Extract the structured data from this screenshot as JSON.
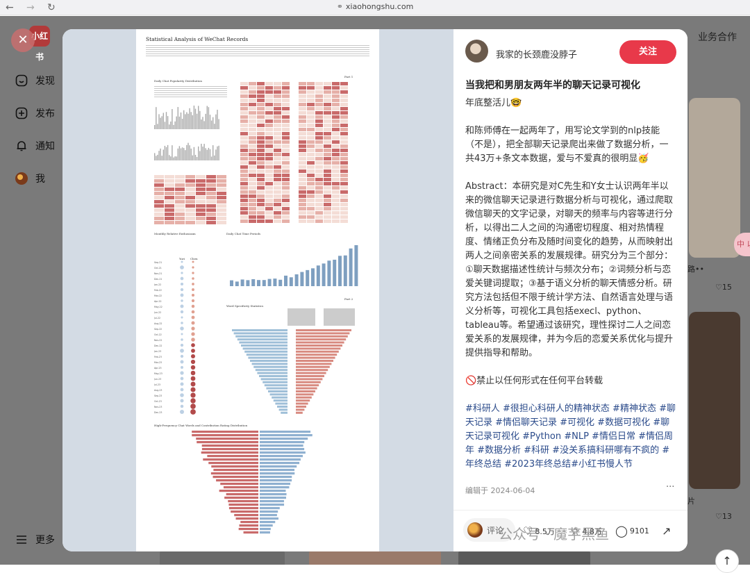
{
  "browser": {
    "url": "xiaohongshu.com"
  },
  "logo": "小红书",
  "sidebar": {
    "items": [
      {
        "label": "发现",
        "icon": "compass-icon"
      },
      {
        "label": "发布",
        "icon": "plus-square-icon"
      },
      {
        "label": "通知",
        "icon": "bell-icon"
      },
      {
        "label": "我",
        "icon": "avatar-icon"
      }
    ],
    "more": "更多"
  },
  "header": {
    "business": "业务合作"
  },
  "background": {
    "likes_a": "15",
    "likes_b": "13",
    "snippet_a": "路••",
    "snippet_b": "片"
  },
  "paper": {
    "title": "Statistical Analysis of WeChat Records",
    "part1": "Part 1",
    "part2": "Part 2",
    "sec_daily": "Daily Chat Popularity Distribution",
    "sec_monthly": "Monthly Relative Enthusiasm",
    "sec_time": "Daily Chat Time Periods",
    "sec_word": "Word Specificity Statistics",
    "sec_freq": "High-Frequency Chat Words and Contribution Rating Distribution",
    "col_a": "Yuri",
    "col_b": "Chen",
    "months": [
      "Sep-21",
      "Oct-21",
      "Nov-21",
      "Dec-21",
      "Jan-22",
      "Feb-22",
      "Mar-22",
      "Apr-22",
      "May-22",
      "Jun-22",
      "Jul-22",
      "Aug-22",
      "Sep-22",
      "Oct-22",
      "Nov-22",
      "Dec-22",
      "Jan-23",
      "Feb-23",
      "Mar-23",
      "Apr-23",
      "May-23",
      "Jun-23",
      "Jul-23",
      "Aug-23",
      "Sep-23",
      "Oct-23",
      "Nov-23",
      "Dec-23"
    ]
  },
  "author": {
    "name": "我家的长颈鹿没脖子",
    "follow": "关注"
  },
  "note": {
    "title": "当我把和男朋友两年半的聊天记录可视化",
    "intro": "年底整活儿🤓",
    "para1": "和陈师傅在一起两年了，用写论文学到的nlp技能（不是），把全部聊天记录爬出来做了数据分析，一共43万+条文本数据，爱与不爱真的很明显🥳",
    "para2": "Abstract：本研究是对C先生和Y女士认识两年半以来的微信聊天记录进行数据分析与可视化，通过爬取微信聊天的文字记录，对聊天的频率与内容等进行分析，以得出二人之间的沟通密切程度、相对热情程度、情绪正负分布及随时间变化的趋势，从而映射出两人之间亲密关系的发展规律。研究分为三个部分：①聊天数据描述性统计与频次分布；②词频分析与恋爱关键词提取；③基于语义分析的聊天情感分析。研究方法包括但不限于统计学方法、自然语言处理与语义分析等，可视化工具包括execl、python、tableau等。希望通过该研究，理性探讨二人之间恋爱关系的发展规律，并为今后的恋爱关系优化与提升提供指导和帮助。",
    "para3": "🚫禁止以任何形式在任何平台转载",
    "tags": "#科研人 #很担心科研人的精神状态 #精神状态 #聊天记录 #情侣聊天记录 #可视化 #数据可视化 #聊天记录可视化 #Python #NLP #情侣日常 #情侣周年 #数据分析 #科研 #没关系搞科研哪有不疯的 #年终总结 #2023年终总结#小红书慢人节",
    "edited": "编辑于 2024-06-04",
    "more": "···"
  },
  "footer": {
    "comment": "评论",
    "likes": "8.5万",
    "collects": "4.8万",
    "comments": "9101"
  },
  "watermark": "公众号 · 魔芋黑鱼",
  "share_tag": "中 以"
}
